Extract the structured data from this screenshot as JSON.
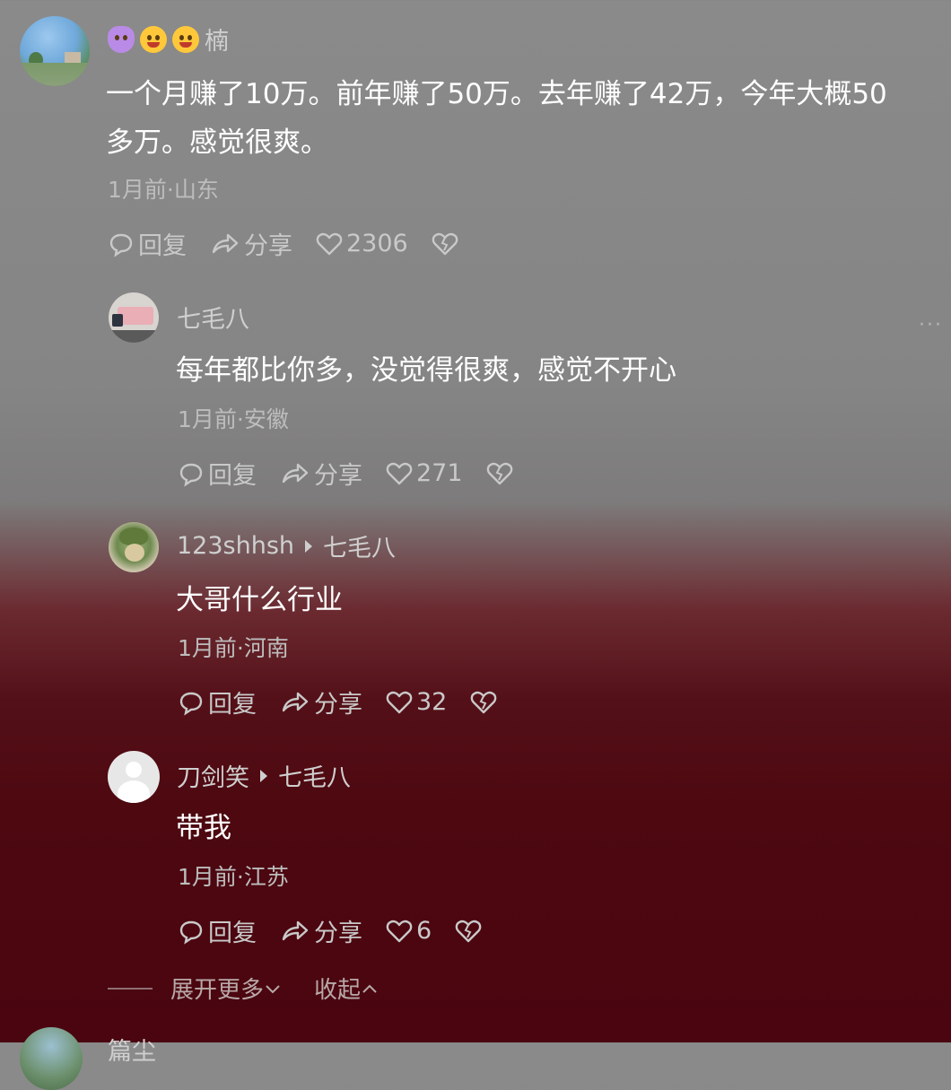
{
  "main_comment": {
    "username_emojis": [
      "devil-emoji",
      "winking-tongue-emoji",
      "laughing-tongue-emoji"
    ],
    "username": "楠",
    "text_line1": "一个月赚了10万。前年赚了50万。去年赚了42万，今年大概50",
    "text_line2": "多万。感觉很爽。",
    "meta": "1月前·山东",
    "reply_label": "回复",
    "share_label": "分享",
    "like_count": "2306"
  },
  "replies": [
    {
      "username": "七毛八",
      "reply_to": "",
      "text": "每年都比你多，没觉得很爽，感觉不开心",
      "meta": "1月前·安徽",
      "reply_label": "回复",
      "share_label": "分享",
      "like_count": "271",
      "more": "···"
    },
    {
      "username": "123shhsh",
      "reply_to": "七毛八",
      "text": "大哥什么行业",
      "meta": "1月前·河南",
      "reply_label": "回复",
      "share_label": "分享",
      "like_count": "32"
    },
    {
      "username": "刀剑笑",
      "reply_to": "七毛八",
      "text": "带我",
      "meta": "1月前·江苏",
      "reply_label": "回复",
      "share_label": "分享",
      "like_count": "6"
    }
  ],
  "footer": {
    "expand_label": "展开更多",
    "collapse_label": "收起"
  },
  "next_comment": {
    "username_partial": "篇尘"
  },
  "colors": {
    "top_bg": "#8a8a8a",
    "bottom_bg": "#4a0510",
    "text": "#ffffff",
    "meta": "#bdbdbd"
  }
}
